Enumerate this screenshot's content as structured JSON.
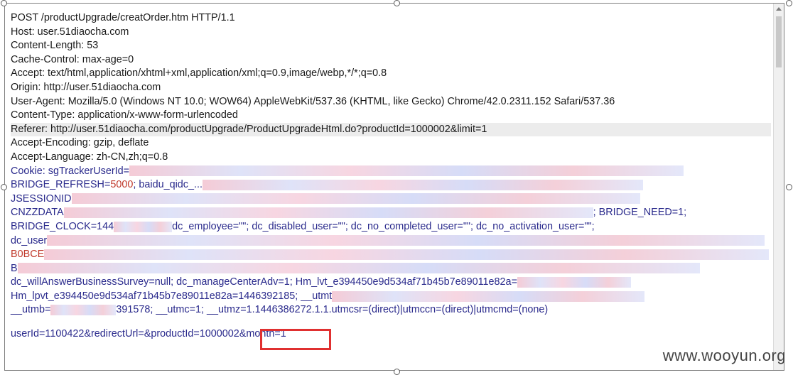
{
  "request": {
    "lines": [
      "POST /productUpgrade/creatOrder.htm HTTP/1.1",
      "Host: user.51diaocha.com",
      "Content-Length: 53",
      "Cache-Control: max-age=0",
      "Accept: text/html,application/xhtml+xml,application/xml;q=0.9,image/webp,*/*;q=0.8",
      "Origin: http://user.51diaocha.com",
      "User-Agent: Mozilla/5.0 (Windows NT 10.0; WOW64) AppleWebKit/537.36 (KHTML, like Gecko) Chrome/42.0.2311.152 Safari/537.36",
      "Content-Type: application/x-www-form-urlencoded",
      "Referer: http://user.51diaocha.com/productUpgrade/ProductUpgradeHtml.do?productId=1000002&limit=1",
      "Accept-Encoding: gzip, deflate",
      "Accept-Language: zh-CN,zh;q=0.8"
    ],
    "cookie": {
      "prefix": "Cookie: sgTrackerUserId=",
      "bridge_refresh_label": "BRIDGE_REFRESH=",
      "bridge_refresh_value": "5000",
      "bridge_refresh_rest": "; baidu_qidc_...",
      "jsession": "JSESSIONID",
      "cnzz": "CNZZDATA",
      "cnzz_tail": "; BRIDGE_NEED=1;",
      "bridge_clock": "BRIDGE_CLOCK=144",
      "bridge_clock_tail": "dc_employee=\"\"; dc_disabled_user=\"\"; dc_no_completed_user=\"\"; dc_no_activation_user=\"\";",
      "dc_user": "dc_user",
      "b0": "B0BCE",
      "b1": "B",
      "will_answer": "dc_willAnswerBusinessSurvey=null; dc_manageCenterAdv=1; Hm_lvt_e394450e9d534af71b45b7e89011e82a=",
      "hm_lpvt": "Hm_lpvt_e394450e9d534af71b45b7e89011e82a=1446392185; __utmt",
      "utmb": "__utmb=",
      "utmb_tail": "391578; __utmc=1; __utmz=1.1446386272.1.1.utmcsr=(direct)|utmccn=(direct)|utmcmd=(none)"
    },
    "body": {
      "prefix": "userId=1100422&redirectUrl=&productId=1000002&",
      "month": "month=1"
    }
  },
  "watermark": "www.wooyun.org"
}
